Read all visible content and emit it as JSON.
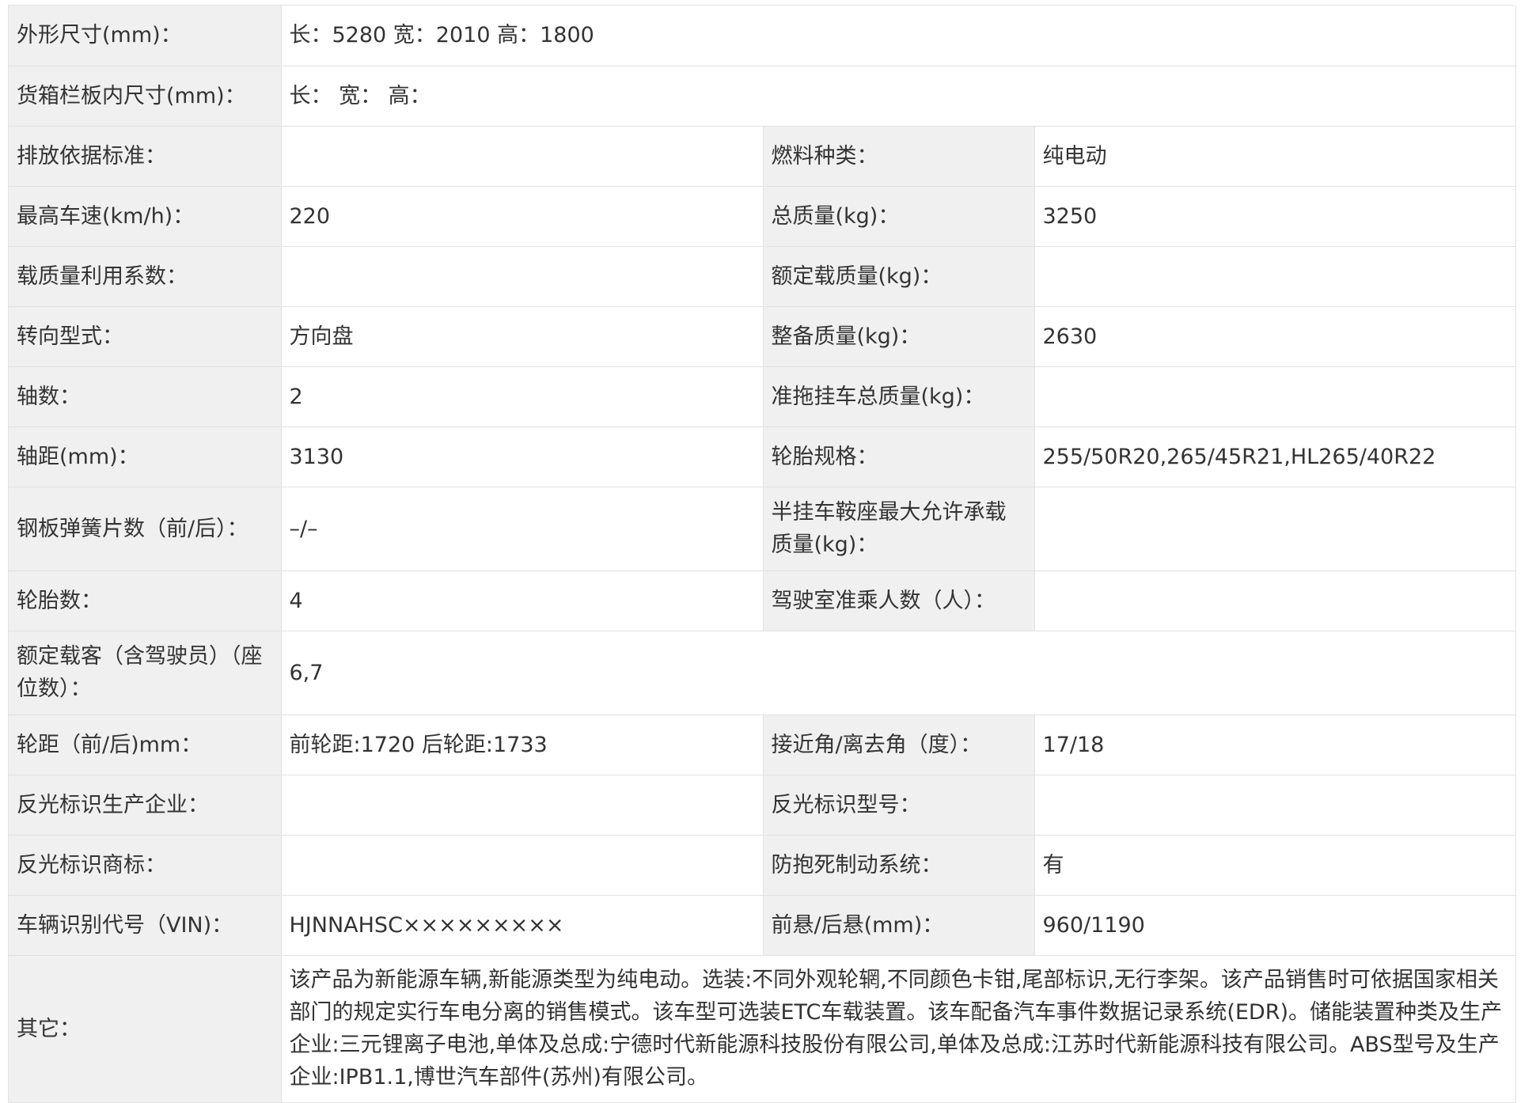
{
  "rows": [
    {
      "l1": "外形尺寸(mm)：",
      "v1": "长：5280 宽：2010 高：1800"
    },
    {
      "l1": "货箱栏板内尺寸(mm)：",
      "v1": "长：  宽：  高："
    },
    {
      "l1": "排放依据标准：",
      "v1": "",
      "l2": "燃料种类：",
      "v2": "纯电动"
    },
    {
      "l1": "最高车速(km/h)：",
      "v1": "220",
      "l2": "总质量(kg)：",
      "v2": "3250"
    },
    {
      "l1": "载质量利用系数：",
      "v1": "",
      "l2": "额定载质量(kg)：",
      "v2": ""
    },
    {
      "l1": "转向型式：",
      "v1": "方向盘",
      "l2": "整备质量(kg)：",
      "v2": "2630"
    },
    {
      "l1": "轴数：",
      "v1": "2",
      "l2": "准拖挂车总质量(kg)：",
      "v2": ""
    },
    {
      "l1": "轴距(mm)：",
      "v1": "3130",
      "l2": "轮胎规格：",
      "v2": "255/50R20,265/45R21,HL265/40R22"
    },
    {
      "l1": "钢板弹簧片数（前/后）：",
      "v1": "–/–",
      "l2": "半挂车鞍座最大允许承载质量(kg)：",
      "v2": ""
    },
    {
      "l1": "轮胎数：",
      "v1": "4",
      "l2": "驾驶室准乘人数（人）：",
      "v2": ""
    },
    {
      "l1": "额定载客（含驾驶员）（座位数）：",
      "v1": "6,7"
    },
    {
      "l1": "轮距（前/后)mm：",
      "v1": "前轮距:1720 后轮距:1733",
      "l2": "接近角/离去角（度）：",
      "v2": "17/18"
    },
    {
      "l1": "反光标识生产企业：",
      "v1": "",
      "l2": "反光标识型号：",
      "v2": ""
    },
    {
      "l1": "反光标识商标：",
      "v1": "",
      "l2": "防抱死制动系统：",
      "v2": "有"
    },
    {
      "l1": "车辆识别代号（VIN)：",
      "v1": "HJNNAHSC×××××××××",
      "l2": "前悬/后悬(mm)：",
      "v2": "960/1190"
    },
    {
      "l1": "其它：",
      "v1": "该产品为新能源车辆,新能源类型为纯电动。选装:不同外观轮辋,不同颜色卡钳,尾部标识,无行李架。该产品销售时可依据国家相关部门的规定实行车电分离的销售模式。该车型可选装ETC车载装置。该车配备汽车事件数据记录系统(EDR)。储能装置种类及生产企业:三元锂离子电池,单体及总成:宁德时代新能源科技股份有限公司,单体及总成:江苏时代新能源科技有限公司。ABS型号及生产企业:IPB1.1,博世汽车部件(苏州)有限公司。"
    }
  ]
}
